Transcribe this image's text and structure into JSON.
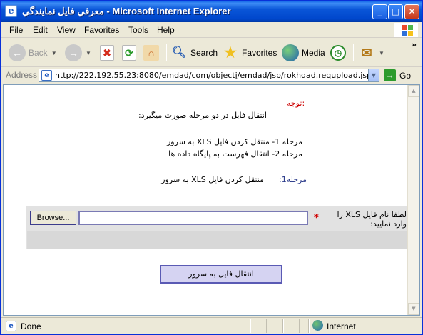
{
  "window": {
    "title": "معرفي فايل نمايندگي - Microsoft Internet Explorer",
    "title_icon": "e",
    "controls": {
      "minimize": "_",
      "maximize": "□",
      "close": "✕"
    }
  },
  "menu": [
    "File",
    "Edit",
    "View",
    "Favorites",
    "Tools",
    "Help"
  ],
  "toolbar": {
    "back": "Back",
    "forward": "",
    "search": "Search",
    "favorites": "Favorites",
    "media": "Media",
    "more": "»"
  },
  "address": {
    "label": "Address",
    "url": "http://222.192.55.23:8080/emdad/com/objectj/emdad/jsp/rokhdad.requpload.jsp",
    "go": "Go"
  },
  "page": {
    "notice_title": "توجه:",
    "notice_intro": "انتقال فايل در دو مرحله صورت ميگيرد:",
    "step1": "مرحله 1- منتقل کردن فايل XLS به سرور",
    "step2": "مرحله 2- انتقال فهرست به پايگاه داده ها",
    "current_step_label": "مرحله1:",
    "current_step_text": "منتقل کردن فايل XLS به سرور",
    "browse_label": "Browse...",
    "file_value": "",
    "required_mark": "*",
    "field_label": "لطفا نام فايل XLS را وارد نماييد:",
    "submit_label": "انتقال فايل به سرور"
  },
  "status": {
    "text": "Done",
    "zone": "Internet"
  },
  "colors": {
    "titlebar": "#0a56d8",
    "notice_red": "#cc0000",
    "label_blue": "#2a3a8a",
    "submit_bg": "#d5d3f2"
  }
}
